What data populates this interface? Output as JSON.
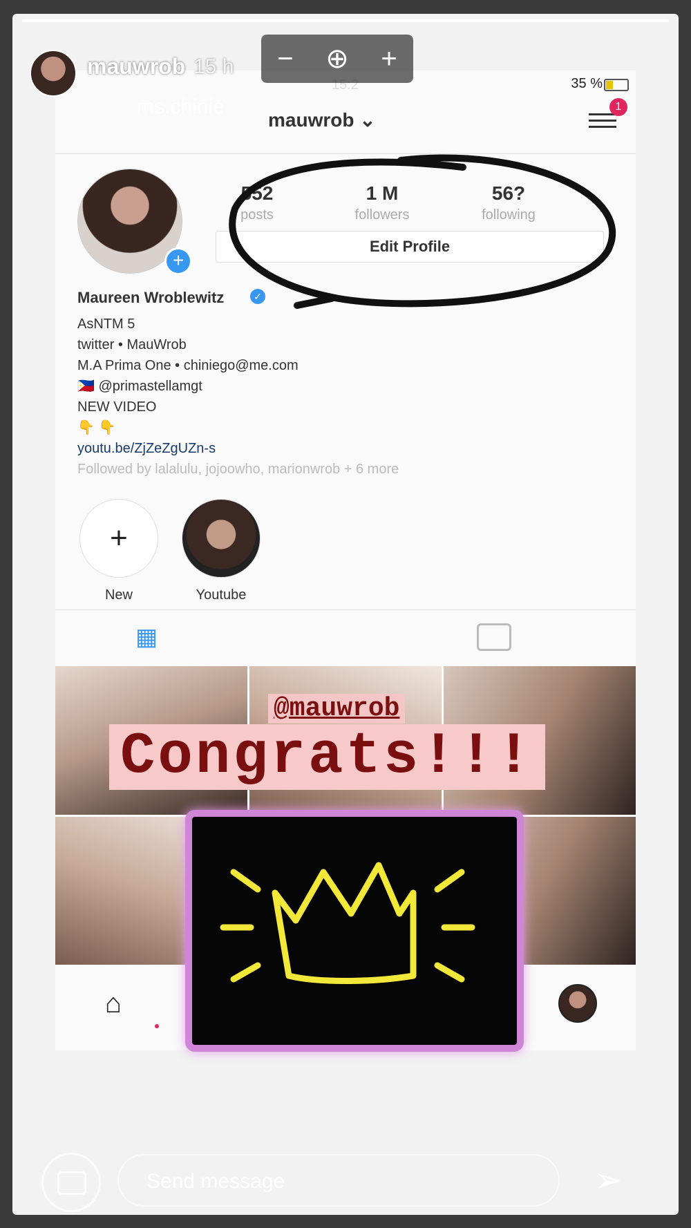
{
  "story": {
    "username": "mauwrob",
    "time": "15 h",
    "reposted_from": "ms.chinie",
    "zoom": {
      "minus": "−",
      "plus": "+"
    }
  },
  "status_bar": {
    "time": "15:2",
    "battery": "35 %"
  },
  "profile": {
    "username": "mauwrob",
    "notification_count": "1",
    "stats": [
      {
        "value": "552",
        "label": "posts"
      },
      {
        "value": "1 M",
        "label": "followers"
      },
      {
        "value": "56?",
        "label": "following"
      }
    ],
    "edit_label": "Edit Profile",
    "full_name": "Maureen Wroblewitz",
    "bio_lines": [
      "AsNTM 5",
      "twitter • MauWrob",
      "M.A Prima One • chiniego@me.com",
      "🇵🇭 @primastellamgt",
      "NEW VIDEO",
      "👇 👇"
    ],
    "link": "youtu.be/ZjZeZgUZn-s",
    "followed_by": "Followed by lalalulu, jojoowho, marionwrob + 6 more"
  },
  "highlights": [
    {
      "label": "New",
      "icon": "+"
    },
    {
      "label": "Youtube"
    }
  ],
  "overlay": {
    "mention": "@mauwrob",
    "congrats": "Congrats!!!"
  },
  "message_bar": {
    "placeholder": "Send message"
  },
  "colors": {
    "accent": "#3897f0",
    "crown": "#f2e83a",
    "crown_border": "#d086d6",
    "congrats": "#7a0f0f"
  }
}
